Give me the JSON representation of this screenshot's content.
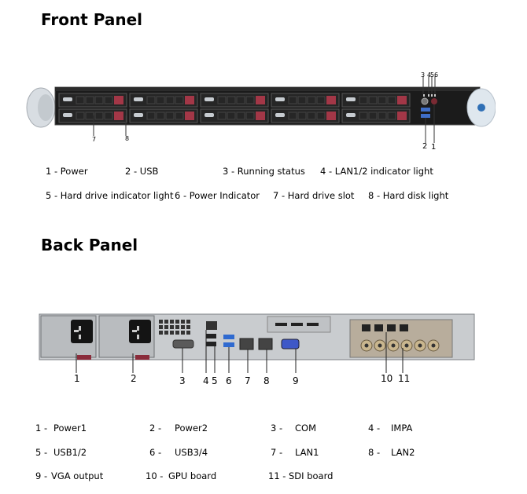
{
  "front_panel": {
    "title": "Front Panel",
    "callouts": [
      "1",
      "2",
      "3",
      "4",
      "5",
      "6",
      "7",
      "8"
    ],
    "legend": [
      {
        "num": "1",
        "label": "1 - Power"
      },
      {
        "num": "2",
        "label": "2 - USB"
      },
      {
        "num": "3",
        "label": "3 - Running status"
      },
      {
        "num": "4",
        "label": "4 - LAN1/2 indicator light"
      },
      {
        "num": "5",
        "label": "5 - Hard drive indicator light"
      },
      {
        "num": "6",
        "label": "6 - Power Indicator"
      },
      {
        "num": "7",
        "label": "7 - Hard drive slot"
      },
      {
        "num": "8",
        "label": "8 - Hard disk light"
      }
    ]
  },
  "back_panel": {
    "title": "Back Panel",
    "callouts": [
      "1",
      "2",
      "3",
      "4",
      "5",
      "6",
      "7",
      "8",
      "9",
      "10",
      "11"
    ],
    "legend": [
      {
        "num": "1 -",
        "label": "Power1"
      },
      {
        "num": "2 -",
        "label": "Power2"
      },
      {
        "num": "3 -",
        "label": "COM"
      },
      {
        "num": "4 -",
        "label": "IMPA"
      },
      {
        "num": "5 -",
        "label": "USB1/2"
      },
      {
        "num": "6 -",
        "label": "USB3/4"
      },
      {
        "num": "7 -",
        "label": "LAN1"
      },
      {
        "num": "8 -",
        "label": "LAN2"
      },
      {
        "num": "9 -",
        "label": "VGA output"
      },
      {
        "num": "10 -",
        "label": "GPU board"
      },
      {
        "num": "11 -",
        "label": "SDI board"
      }
    ]
  }
}
